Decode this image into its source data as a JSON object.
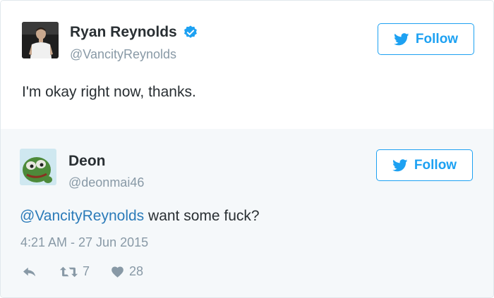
{
  "quoted_tweet": {
    "author_name": "Ryan Reynolds",
    "author_handle": "@VancityReynolds",
    "verified_icon": "verified-badge-icon",
    "text": "I'm okay right now, thanks.",
    "follow_label": "Follow"
  },
  "reply_tweet": {
    "author_name": "Deon",
    "author_handle": "@deonmai46",
    "follow_label": "Follow",
    "mention": "@VancityReynolds",
    "text_rest": " want some fuck?",
    "timestamp": "4:21 AM - 27 Jun 2015",
    "actions": {
      "reply_icon": "reply-icon",
      "retweet_icon": "retweet-icon",
      "retweet_count": "7",
      "like_icon": "heart-icon",
      "like_count": "28"
    }
  },
  "colors": {
    "accent": "#1da1f2",
    "link": "#2b7bb9",
    "muted": "#8899a6",
    "reply_background": "#f5f8fa"
  }
}
